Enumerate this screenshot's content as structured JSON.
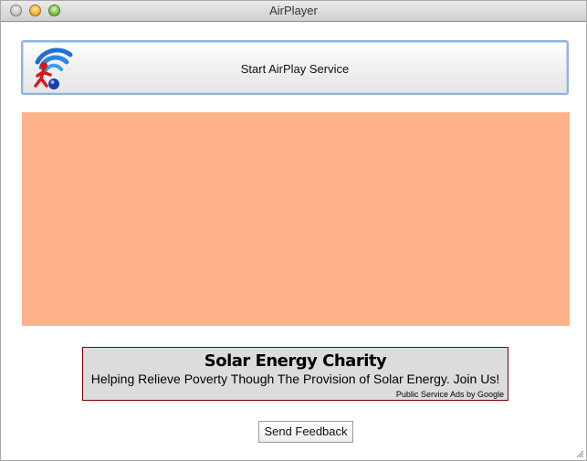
{
  "window": {
    "title": "AirPlayer"
  },
  "main": {
    "start_button_label": "Start AirPlay Service",
    "content_area_color": "#ffb28a"
  },
  "ad": {
    "title": "Solar Energy Charity",
    "body": "Helping Relieve Poverty Though The Provision of Solar Energy. Join Us!",
    "credit": "Public Service Ads by Google"
  },
  "footer": {
    "feedback_label": "Send Feedback"
  },
  "icons": {
    "app": "airplay-wifi-person-icon",
    "resize": "resize-grip-icon"
  }
}
